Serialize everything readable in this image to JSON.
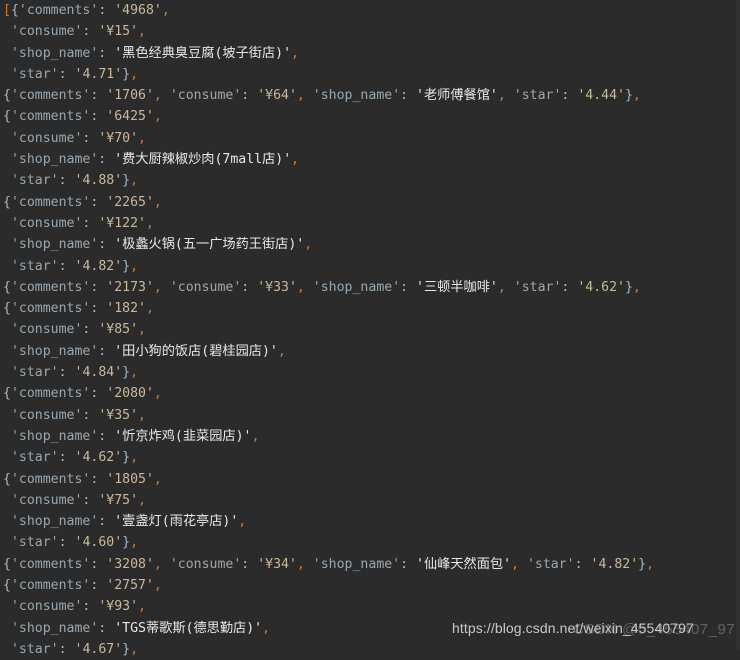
{
  "app": {
    "background_color": "#2b2b2b",
    "text_color": "#a9b7c6",
    "kind": "python-console-output"
  },
  "watermark": {
    "url": "https://blog.csdn.net/weixin_45540797",
    "ghost": "CSDN @5_455407_97"
  },
  "output": {
    "open_bracket": "[",
    "lines": [
      {
        "id": "l1",
        "indent": 0,
        "text": "[{'comments': '4968',"
      },
      {
        "id": "l2",
        "indent": 1,
        "text": " 'consume': '¥15',"
      },
      {
        "id": "l3",
        "indent": 1,
        "text": " 'shop_name': '黑色经典臭豆腐(坡子街店)',"
      },
      {
        "id": "l4",
        "indent": 1,
        "text": " 'star': '4.71'},"
      },
      {
        "id": "l5",
        "indent": 1,
        "text": "{'comments': '1706', 'consume': '¥64', 'shop_name': '老师傅餐馆', 'star': '4.44'},"
      },
      {
        "id": "l6",
        "indent": 1,
        "text": "{'comments': '6425',"
      },
      {
        "id": "l7",
        "indent": 1,
        "text": " 'consume': '¥70',"
      },
      {
        "id": "l8",
        "indent": 1,
        "text": " 'shop_name': '费大厨辣椒炒肉(7mall店)',"
      },
      {
        "id": "l9",
        "indent": 1,
        "text": " 'star': '4.88'},"
      },
      {
        "id": "l10",
        "indent": 1,
        "text": "{'comments': '2265',"
      },
      {
        "id": "l11",
        "indent": 1,
        "text": " 'consume': '¥122',"
      },
      {
        "id": "l12",
        "indent": 1,
        "text": " 'shop_name': '极蠡火锅(五一广场药王街店)',"
      },
      {
        "id": "l13",
        "indent": 1,
        "text": " 'star': '4.82'},"
      },
      {
        "id": "l14",
        "indent": 1,
        "text": "{'comments': '2173', 'consume': '¥33', 'shop_name': '三顿半咖啡', 'star': '4.62'},"
      },
      {
        "id": "l15",
        "indent": 1,
        "text": "{'comments': '182',"
      },
      {
        "id": "l16",
        "indent": 1,
        "text": " 'consume': '¥85',"
      },
      {
        "id": "l17",
        "indent": 1,
        "text": " 'shop_name': '田小狗的饭店(碧桂园店)',"
      },
      {
        "id": "l18",
        "indent": 1,
        "text": " 'star': '4.84'},"
      },
      {
        "id": "l19",
        "indent": 1,
        "text": "{'comments': '2080',"
      },
      {
        "id": "l20",
        "indent": 1,
        "text": " 'consume': '¥35',"
      },
      {
        "id": "l21",
        "indent": 1,
        "text": " 'shop_name': '忻京炸鸡(韭菜园店)',"
      },
      {
        "id": "l22",
        "indent": 1,
        "text": " 'star': '4.62'},"
      },
      {
        "id": "l23",
        "indent": 1,
        "text": "{'comments': '1805',"
      },
      {
        "id": "l24",
        "indent": 1,
        "text": " 'consume': '¥75',"
      },
      {
        "id": "l25",
        "indent": 1,
        "text": " 'shop_name': '壹盏灯(雨花亭店)',"
      },
      {
        "id": "l26",
        "indent": 1,
        "text": " 'star': '4.60'},"
      },
      {
        "id": "l27",
        "indent": 1,
        "text": "{'comments': '3208', 'consume': '¥34', 'shop_name': '仙峰天然面包', 'star': '4.82'},"
      },
      {
        "id": "l28",
        "indent": 1,
        "text": "{'comments': '2757',"
      },
      {
        "id": "l29",
        "indent": 1,
        "text": " 'consume': '¥93',"
      },
      {
        "id": "l30",
        "indent": 1,
        "text": " 'shop_name': 'TGS蒂歌斯(德思勤店)',"
      },
      {
        "id": "l31",
        "indent": 1,
        "text": " 'star': '4.67'},"
      }
    ]
  },
  "records": [
    {
      "comments": "4968",
      "consume": "¥15",
      "shop_name": "黑色经典臭豆腐(坡子街店)",
      "star": "4.71"
    },
    {
      "comments": "1706",
      "consume": "¥64",
      "shop_name": "老师傅餐馆",
      "star": "4.44"
    },
    {
      "comments": "6425",
      "consume": "¥70",
      "shop_name": "费大厨辣椒炒肉(7mall店)",
      "star": "4.88"
    },
    {
      "comments": "2265",
      "consume": "¥122",
      "shop_name": "极蠡火锅(五一广场药王街店)",
      "star": "4.82"
    },
    {
      "comments": "2173",
      "consume": "¥33",
      "shop_name": "三顿半咖啡",
      "star": "4.62"
    },
    {
      "comments": "182",
      "consume": "¥85",
      "shop_name": "田小狗的饭店(碧桂园店)",
      "star": "4.84"
    },
    {
      "comments": "2080",
      "consume": "¥35",
      "shop_name": "忻京炸鸡(韭菜园店)",
      "star": "4.62"
    },
    {
      "comments": "1805",
      "consume": "¥75",
      "shop_name": "壹盏灯(雨花亭店)",
      "star": "4.60"
    },
    {
      "comments": "3208",
      "consume": "¥34",
      "shop_name": "仙峰天然面包",
      "star": "4.82"
    },
    {
      "comments": "2757",
      "consume": "¥93",
      "shop_name": "TGS蒂歌斯(德思勤店)",
      "star": "4.67"
    }
  ]
}
